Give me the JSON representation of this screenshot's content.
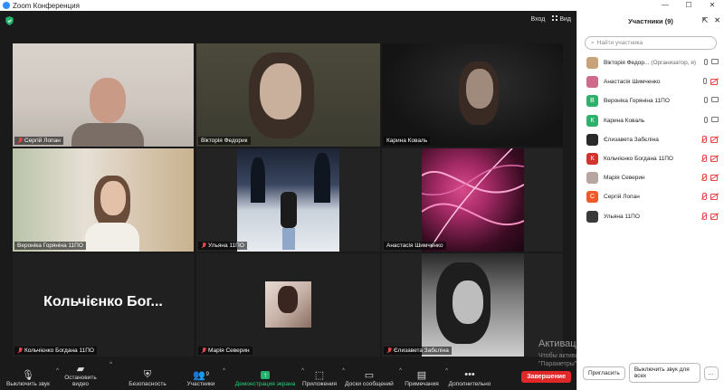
{
  "window": {
    "title": "Zoom Конференция"
  },
  "topbar": {
    "enter_label": "Вход",
    "view_label": "Вид"
  },
  "tiles": [
    {
      "name": "Сергій Лопан",
      "muted": true
    },
    {
      "name": "Вікторія Федорик",
      "muted": false,
      "active": true
    },
    {
      "name": "Карина Коваль",
      "muted": false
    },
    {
      "name": "Вероніка Горянiна 11ПО",
      "muted": false
    },
    {
      "name": "Ульяна 11ПО",
      "muted": true
    },
    {
      "name": "Анастасія Шимченко",
      "muted": false
    },
    {
      "name": "Кольчієнко Богдана 11ПО",
      "muted": true,
      "display": "Кольчієнко Бог..."
    },
    {
      "name": "Марія Северин",
      "muted": true
    },
    {
      "name": "Єлизавета Забєліна",
      "muted": true
    }
  ],
  "toolbar": {
    "mute": "Выключить звук",
    "video": "Остановить видео",
    "security": "Безопасность",
    "participants": "Участники",
    "participants_count": "9",
    "share": "Демонстрация экрана",
    "apps": "Приложения",
    "chat": "Доски сообщений",
    "notes": "Примечания",
    "more": "Дополнительно",
    "end": "Завершение"
  },
  "watermark": {
    "line1": "Активация Windows",
    "line2": "Чтобы активировать Windows, перейдите в раздел \"Параметры\"."
  },
  "panel": {
    "title": "Участники (9)",
    "search_placeholder": "Найти участника",
    "participants": [
      {
        "name": "Вікторія Федор...",
        "tag": "(Организатор, я)",
        "avatar": "",
        "color": "#c9a27a"
      },
      {
        "name": "Анастасія Шимченко",
        "tag": "",
        "avatar": "",
        "color": "#d06a8a"
      },
      {
        "name": "Вероніка Горянiна 11ПО",
        "tag": "",
        "avatar": "В",
        "color": "#2fb06b"
      },
      {
        "name": "Карина Коваль",
        "tag": "",
        "avatar": "К",
        "color": "#2fb06b"
      },
      {
        "name": "Єлизавета Забєліна",
        "tag": "",
        "avatar": "",
        "color": "#2a2a2a"
      },
      {
        "name": "Кольчієнко Богдана 11ПО",
        "tag": "",
        "avatar": "К",
        "color": "#d1342c"
      },
      {
        "name": "Марія Северин",
        "tag": "",
        "avatar": "",
        "color": "#b7a6a0"
      },
      {
        "name": "Сергій Лопан",
        "tag": "",
        "avatar": "С",
        "color": "#f05a2a"
      },
      {
        "name": "Ульяна 11ПО",
        "tag": "",
        "avatar": "",
        "color": "#3a3a3a"
      }
    ],
    "invite_label": "Пригласить",
    "mute_all_label": "Выключить звук для всех"
  }
}
